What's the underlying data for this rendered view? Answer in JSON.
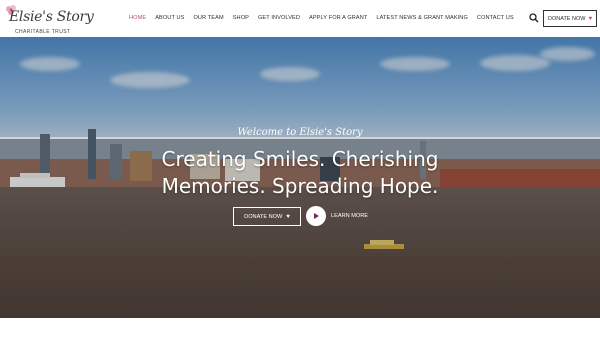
{
  "brand": {
    "name": "Elsie's Story",
    "tagline": "CHARITABLE TRUST"
  },
  "nav": {
    "items": [
      {
        "label": "HOME",
        "active": true
      },
      {
        "label": "ABOUT US",
        "active": false
      },
      {
        "label": "OUR TEAM",
        "active": false
      },
      {
        "label": "SHOP",
        "active": false
      },
      {
        "label": "GET INVOLVED",
        "active": false
      },
      {
        "label": "APPLY FOR A GRANT",
        "active": false
      },
      {
        "label": "LATEST NEWS & GRANT MAKING",
        "active": false
      },
      {
        "label": "CONTACT US",
        "active": false
      }
    ],
    "search_icon": "search-icon",
    "donate_label": "DONATE NOW",
    "heart_icon": "heart-icon"
  },
  "hero": {
    "welcome": "Welcome to Elsie's Story",
    "title": "Creating Smiles. Cherishing Memories. Spreading Hope.",
    "donate_label": "DONATE NOW",
    "learn_label": "LEARN MORE",
    "play_icon": "play-icon"
  },
  "colors": {
    "accent": "#b0507c",
    "heart": "#c04a6f"
  }
}
